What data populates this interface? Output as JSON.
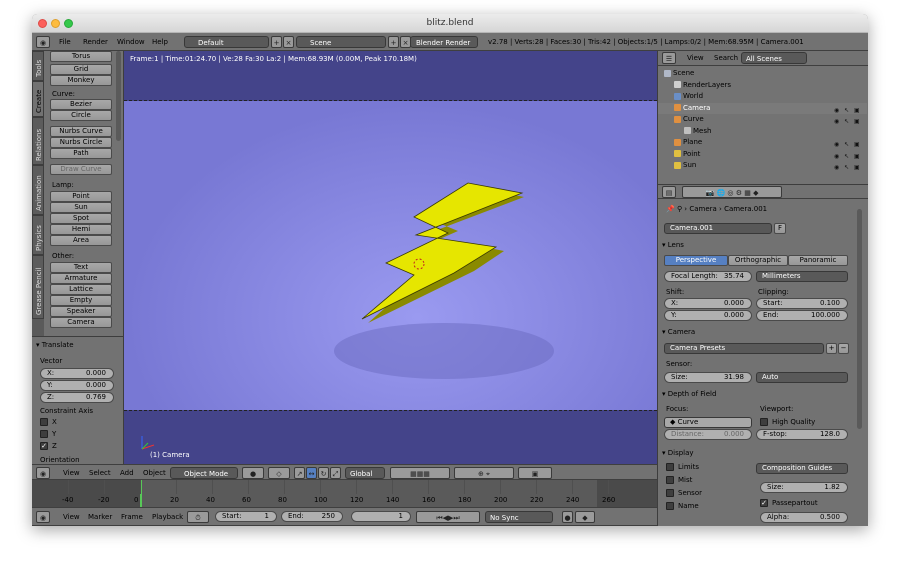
{
  "window": {
    "title": "blitz.blend"
  },
  "topbar": {
    "menus": [
      "File",
      "Render",
      "Window",
      "Help"
    ],
    "layout": "Default",
    "scene": "Scene",
    "engine": "Blender Render",
    "stats": "v2.78 | Verts:28 | Faces:30 | Tris:42 | Objects:1/5 | Lamps:0/2 | Mem:68.95M | Camera.001"
  },
  "toolshelf": {
    "tabs": [
      "Tools",
      "Create",
      "Relations",
      "Animation",
      "Physics",
      "Grease Pencil"
    ],
    "top_item": "Torus",
    "mesh_buttons": [
      "Grid",
      "Monkey"
    ],
    "curve_label": "Curve:",
    "curve_buttons": [
      "Bezier",
      "Circle",
      "Nurbs Curve",
      "Nurbs Circle",
      "Path"
    ],
    "draw_curve": "Draw Curve",
    "lamp_label": "Lamp:",
    "lamp_buttons": [
      "Point",
      "Sun",
      "Spot",
      "Hemi",
      "Area"
    ],
    "other_label": "Other:",
    "other_buttons": [
      "Text",
      "Armature",
      "Lattice",
      "Empty",
      "Speaker",
      "Camera"
    ]
  },
  "operator": {
    "title": "Translate",
    "vector_label": "Vector",
    "x_label": "X:",
    "x": "0.000",
    "y_label": "Y:",
    "y": "0.000",
    "z_label": "Z:",
    "z": "0.769",
    "constraint_label": "Constraint Axis",
    "axes": [
      {
        "label": "X",
        "checked": false
      },
      {
        "label": "Y",
        "checked": false
      },
      {
        "label": "Z",
        "checked": true
      }
    ],
    "orientation": "Orientation"
  },
  "viewport": {
    "info": "Frame:1 | Time:01:24.70 | Ve:28 Fa:30 La:2 | Mem:68.93M (0.00M, Peak 170.18M)",
    "object_label": "(1) Camera"
  },
  "view_header": {
    "menus": [
      "View",
      "Select",
      "Add",
      "Object"
    ],
    "mode": "Object Mode",
    "orientation": "Global"
  },
  "timeline": {
    "ticks": [
      "-40",
      "-20",
      "0",
      "20",
      "40",
      "60",
      "80",
      "100",
      "120",
      "140",
      "160",
      "180",
      "200",
      "220",
      "240",
      "260"
    ],
    "current_frame": 1,
    "menus": [
      "View",
      "Marker",
      "Frame",
      "Playback"
    ],
    "start_label": "Start:",
    "start": "1",
    "end_label": "End:",
    "end": "250",
    "current": "1",
    "sync": "No Sync"
  },
  "outliner": {
    "menus": [
      "View",
      "Search"
    ],
    "filter": "All Scenes",
    "items": [
      {
        "label": "Scene",
        "indent": 0,
        "icon": "#b0b8c8"
      },
      {
        "label": "RenderLayers",
        "indent": 1,
        "icon": "#d0d0d0"
      },
      {
        "label": "World",
        "indent": 1,
        "icon": "#6a8fc7"
      },
      {
        "label": "Camera",
        "indent": 1,
        "icon": "#e09040",
        "selected": true
      },
      {
        "label": "Curve",
        "indent": 1,
        "icon": "#e09040"
      },
      {
        "label": "Mesh",
        "indent": 2,
        "icon": "#c0c0c0"
      },
      {
        "label": "Plane",
        "indent": 1,
        "icon": "#e09040"
      },
      {
        "label": "Point",
        "indent": 1,
        "icon": "#e0c040"
      },
      {
        "label": "Sun",
        "indent": 1,
        "icon": "#e0c040"
      }
    ]
  },
  "properties": {
    "breadcrumb_a": "Camera",
    "breadcrumb_b": "Camera.001",
    "datablock": "Camera.001",
    "datablock_flag": "F",
    "lens": {
      "title": "Lens",
      "tabs": [
        "Perspective",
        "Orthographic",
        "Panoramic"
      ],
      "focal_label": "Focal Length:",
      "focal": "35.74",
      "units": "Millimeters",
      "shift_label": "Shift:",
      "clipping_label": "Clipping:",
      "shift_x_label": "X:",
      "shift_x": "0.000",
      "shift_y_label": "Y:",
      "shift_y": "0.000",
      "clip_start_label": "Start:",
      "clip_start": "0.100",
      "clip_end_label": "End:",
      "clip_end": "100.000"
    },
    "camera": {
      "title": "Camera",
      "presets": "Camera Presets",
      "sensor_label": "Sensor:",
      "size_label": "Size:",
      "size": "31.98",
      "fit": "Auto"
    },
    "dof": {
      "title": "Depth of Field",
      "focus_label": "Focus:",
      "viewport_label": "Viewport:",
      "focus_obj": "Curve",
      "high_quality": "High Quality",
      "distance_label": "Distance:",
      "distance": "0.000",
      "fstop_label": "F-stop:",
      "fstop": "128.0"
    },
    "display": {
      "title": "Display",
      "checks": [
        "Limits",
        "Mist",
        "Sensor",
        "Name"
      ],
      "guides": "Composition Guides",
      "size_label": "Size:",
      "size": "1.82",
      "passepartout": "Passepartout",
      "alpha_label": "Alpha:",
      "alpha": "0.500"
    }
  },
  "colors": {
    "bolt": "#e6e600",
    "viewport": "#7d7dd6",
    "panel": "#727272"
  }
}
